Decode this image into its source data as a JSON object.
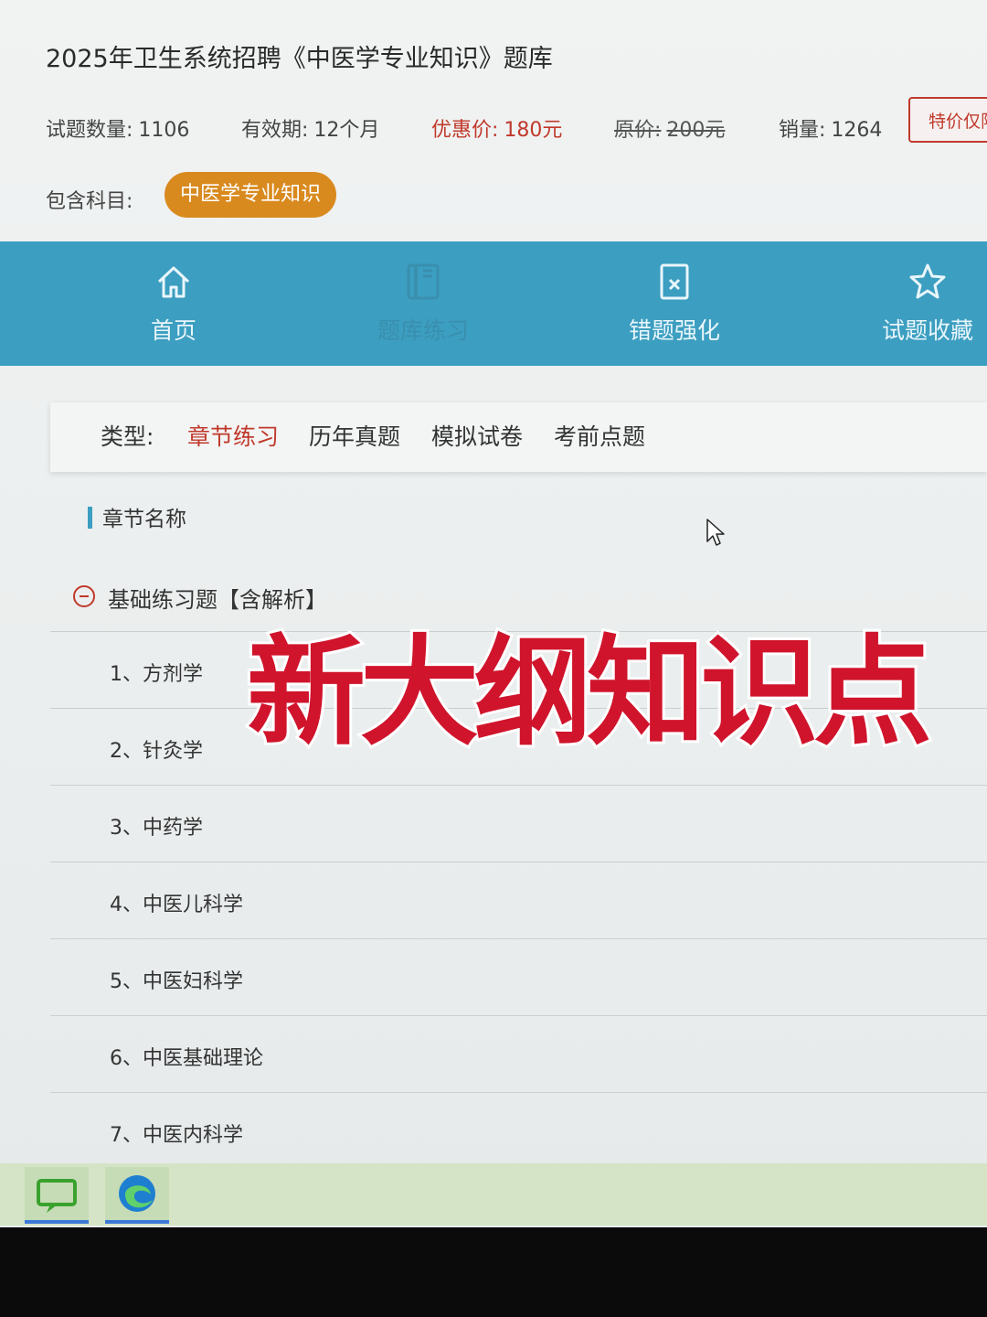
{
  "header": {
    "title": "2025年卫生系统招聘《中医学专业知识》题库",
    "count_label": "试题数量:",
    "count_value": "1106",
    "valid_label": "有效期:",
    "valid_value": "12个月",
    "sale_label": "优惠价:",
    "sale_value": "180元",
    "orig_label": "原价:",
    "orig_value": "200元",
    "sold_label": "销量:",
    "sold_value": "1264",
    "promo": "特价仅限",
    "subject_label": "包含科目:",
    "subject_value": "中医学专业知识"
  },
  "nav": {
    "home": "首页",
    "bank": "题库练习",
    "wrong": "错题强化",
    "fav": "试题收藏"
  },
  "types": {
    "label": "类型:",
    "chapter": "章节练习",
    "past": "历年真题",
    "mock": "模拟试卷",
    "pre": "考前点题"
  },
  "list": {
    "section": "章节名称",
    "group": "基础练习题【含解析】",
    "chapters": [
      "1、方剂学",
      "2、针灸学",
      "3、中药学",
      "4、中医儿科学",
      "5、中医妇科学",
      "6、中医基础理论",
      "7、中医内科学"
    ]
  },
  "overlay": "新大纲知识点",
  "colors": {
    "accent": "#3c9ec0",
    "price_red": "#c0392b",
    "subject_orange": "#d98a1f",
    "overlay_red": "#d0142c"
  }
}
